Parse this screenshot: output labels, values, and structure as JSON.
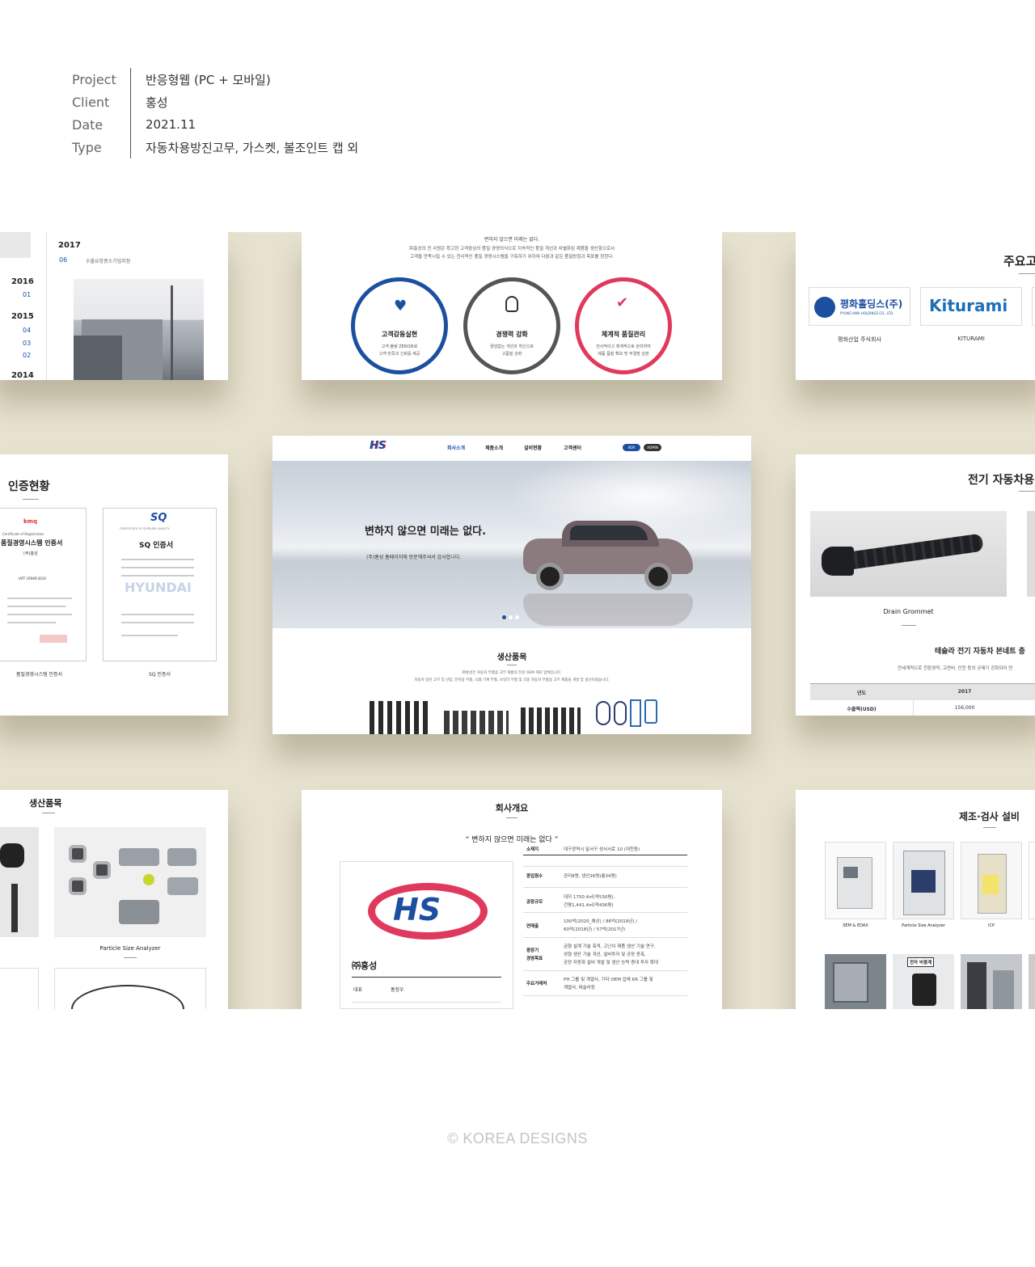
{
  "info": {
    "rows": [
      {
        "label": "Project",
        "value": "반응형웹 (PC + 모바일)"
      },
      {
        "label": "Client",
        "value": "홍성"
      },
      {
        "label": "Date",
        "value": "2021.11"
      },
      {
        "label": "Type",
        "value": "자동차용방진고무, 가스켓, 볼조인트 캡 외"
      }
    ]
  },
  "history": {
    "years": [
      "2017",
      "2016",
      "2015",
      "2014"
    ],
    "months_2017": [
      "06"
    ],
    "note_2017": "수출유망중소기업지정",
    "months_2016": [
      "01"
    ],
    "months_2015": [
      "04",
      "03",
      "02"
    ]
  },
  "quality": {
    "line1": "변하지 않으면 미래는 없다.",
    "line2": "㈜홍성의 전 사원은 확고한 고객중심의 품질 경영의식으로 지속적인 품질 개선과 차별화된 제품을 생산함으로서",
    "line3": "고객을 만족시킬 수 있는 전사적인 품질 경영시스템을 구축하기 위하여 다음과 같은 품질방침과 목표를 정한다.",
    "items": [
      {
        "title": "고객감동실현",
        "desc1": "고객 불량 ZERO화로",
        "desc2": "고객 만족과 신뢰를 제공",
        "color": "#1d4fa0"
      },
      {
        "title": "경쟁력 강화",
        "desc1": "끊임없는 개선과 혁신으로",
        "desc2": "고품질 강화",
        "color": "#555555"
      },
      {
        "title": "체계적 품질관리",
        "desc1": "전사적이고 체계적으로 관리하여",
        "desc2": "제품 품질 확보 및 무결점 실현",
        "color": "#e0395d"
      }
    ]
  },
  "clients": {
    "title": "주요고",
    "logos": [
      {
        "name": "평화홀딩스(주)",
        "sub": "PYUNG HWA HOLDINGS CO., LTD.",
        "caption": "평화산업 주식회사"
      },
      {
        "name": "Kiturami",
        "caption": "KITURAMI"
      }
    ]
  },
  "cert": {
    "title": "인증현황",
    "doc1_mark": "kmq",
    "doc1_en": "Certificate of Registration",
    "doc1_title": "품질경영시스템 인증서",
    "doc1_company": "(주)홍성",
    "doc1_std": "IATF 16949:2016",
    "doc2_logo": "SQ",
    "doc2_head": "CERTIFICATE OF SUPPLIER QUALITY",
    "doc2_title": "SQ 인증서",
    "doc2_wm": "HYUNDAI",
    "captions": [
      "품질경영시스템 인증서",
      "SQ 인증서"
    ]
  },
  "main": {
    "logo": "HS",
    "nav": [
      "회사소개",
      "제품소개",
      "설비현황",
      "고객센터"
    ],
    "lang": [
      "KOR",
      "ADMIN"
    ],
    "hero_title": "변하지 않으면 미래는 없다.",
    "hero_sub": "(주)홍성 홈페이지에 방문해주셔서 감사합니다.",
    "products_title": "생산품목",
    "products_desc1": "㈜홍성은 자동차 부품용 고무 제품의 전문 OEM 제조 업체입니다.",
    "products_desc2": "자동차 방진 고무 및 산업, 전자용 부품, 식품 기계 부품, 보일러 부품 및 각종 자동차 부품용 고무 제품을 개발 및 생산하였습니다."
  },
  "ev": {
    "title": "전기 자동차용",
    "product": "Drain Grommet",
    "subtitle": "테슬라 전기 자동차 본네트 충",
    "desc": "전세계적으로 친환경적, 고연비, 안전 등의 규제가 강화되어 연",
    "table_head": [
      "년도",
      "2017"
    ],
    "table_row": [
      "수출액(USD)",
      "156,000"
    ]
  },
  "products2": {
    "title": "생산품목",
    "caption": "Particle Size Analyzer"
  },
  "company": {
    "title": "회사개요",
    "motto": "“ 변하지 않으면 미래는 없다 ”",
    "logo": "HS",
    "name": "㈜홍성",
    "ceo_label": "대표",
    "ceo": "홍정우",
    "rows": [
      {
        "k": "소재지",
        "v": "대구광역시 달서구 성서서로 10 (대천동)"
      },
      {
        "k": "종업원수",
        "v": "관리8명, 생산26명(총34명)"
      },
      {
        "k": "공장규모",
        "v": "대지 1750.4㎡(약530평),",
        "v2": "건평1,441.4㎡(약436평)"
      },
      {
        "k": "연매출",
        "v": "100억(2020_예상) / 86억(2019년) /",
        "v2": "60억(2018년) / 57억(2017년)"
      },
      {
        "k": "중장기",
        "k2": "경영목표",
        "v": "금형 설계 기술 축적, 고난이 제품 생산 기술 연구,",
        "v2": "성형 생산 기술 개선, 설비투자 및 공장 증축,",
        "v3": "공정 자동화 설비 개발 및 생산 능력 증대 투자 확대"
      },
      {
        "k": "주요거래처",
        "v": "PH 그룹 및 계열사, 기타 OEM 업체 KR 그룹 및",
        "v2": "계열사, 테슬라등"
      }
    ]
  },
  "equip": {
    "title": "제조·검사 설비",
    "captions": [
      "SEM & EDAX",
      "Particle Size Analyzer",
      "ICP"
    ],
    "sign": "전자 비중계"
  },
  "footer": "© KOREA DESIGNS",
  "colors": {
    "band": "#e7e2cf",
    "blue": "#1d4fa0",
    "red": "#e0395d"
  }
}
